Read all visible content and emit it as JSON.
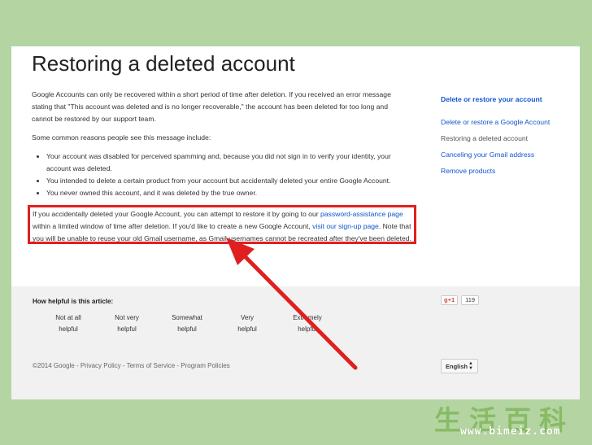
{
  "article": {
    "title": "Restoring a deleted account",
    "p1": "Google Accounts can only be recovered within a short period of time after deletion. If you received an error message stating that \"This account was deleted and is no longer recoverable,\" the account has been deleted for too long and cannot be restored by our support team.",
    "p2": "Some common reasons people see this message include:",
    "bullets": [
      "Your account was disabled for perceived spamming and, because you did not sign in to verify your identity, your account was deleted.",
      "You intended to delete a certain product from your account but accidentally deleted your entire Google Account.",
      "You never owned this account, and it was deleted by the true owner."
    ],
    "highlight": {
      "t1": "If you accidentally deleted your Google Account, you can attempt to restore it by going to our ",
      "link1": "password-assistance page",
      "t2": " within a limited window of time after deletion. If you'd like to create a new Google Account, ",
      "link2": "visit our sign-up page",
      "t3": ". Note that you will be unable to reuse your old Gmail username, as Gmail usernames cannot be recreated after they've been deleted."
    }
  },
  "sidebar": {
    "heading": "Delete or restore your account",
    "items": [
      "Delete or restore a Google Account",
      "Restoring a deleted account",
      "Canceling your Gmail address",
      "Remove products"
    ]
  },
  "footer": {
    "helpful_question": "How helpful is this article:",
    "ratings": [
      {
        "line1": "Not at all",
        "line2": "helpful"
      },
      {
        "line1": "Not very",
        "line2": "helpful"
      },
      {
        "line1": "Somewhat",
        "line2": "helpful"
      },
      {
        "line1": "Very",
        "line2": "helpful"
      },
      {
        "line1": "Extremely",
        "line2": "helpful"
      }
    ],
    "gplus_label": "g+1",
    "gplus_count": "119",
    "legal": {
      "copyright": "©2014 Google",
      "privacy": "Privacy Policy",
      "terms": "Terms of Service",
      "programs": "Program Policies",
      "sep": " - "
    },
    "language": "English"
  },
  "watermark": {
    "chars": "生活百科",
    "url": "www.bimeiz.com"
  },
  "colors": {
    "background": "#b4d4a2",
    "link": "#1155cc",
    "highlight_border": "#e02020",
    "arrow": "#e02020"
  }
}
